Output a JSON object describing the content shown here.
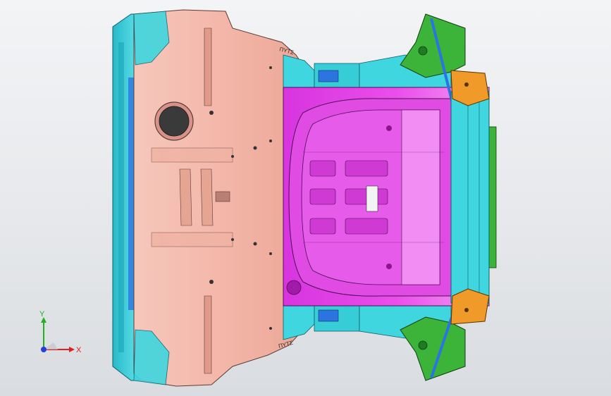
{
  "viewport": {
    "background_top": "#f3f4f6",
    "background_bottom": "#d9dce0"
  },
  "model": {
    "colors": {
      "front_panel": "#f3b7a9",
      "front_panel_shade": "#e19a89",
      "side_rail": "#3fd6df",
      "side_rail_dark": "#1aa5b8",
      "center_tub": "#e43fe7",
      "center_tub_dark": "#b51fc0",
      "center_tub_light": "#f28df4",
      "rear_bracket": "#3cb43a",
      "rear_bracket_dark": "#1e7b21",
      "bracket_orange": "#f09a2a",
      "fastener_blue": "#2c74e0",
      "edge_line": "#3b2a2a"
    },
    "stamp_top": "ΠΥΤΣ",
    "stamp_bottom": "ΠΥΤΣ"
  },
  "triad": {
    "x_label": "X",
    "y_label": "Y",
    "x_color": "#e02020",
    "y_color": "#20b020",
    "z_color": "#2040e0"
  }
}
